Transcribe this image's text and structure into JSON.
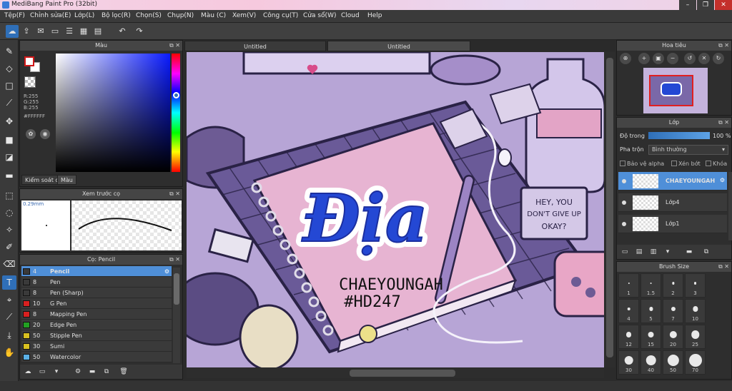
{
  "app": {
    "title": "MediBang Paint Pro (32bit)",
    "window_buttons": [
      "–",
      "❐",
      "✕"
    ]
  },
  "menu": [
    "Tệp(F)",
    "Chỉnh sửa(E)",
    "Lớp(L)",
    "Bộ lọc(R)",
    "Chọn(S)",
    "Chụp(N)",
    "Màu (C)",
    "Xem(V)",
    "Công cụ(T)",
    "Cửa sổ(W)",
    "Cloud",
    "Help"
  ],
  "toolbar_icons": [
    "cloud-icon",
    "share-icon",
    "comment-icon",
    "document-icon",
    "note-icon",
    "grid-icon",
    "tiles-icon",
    "undo-icon",
    "redo-icon"
  ],
  "color_panel": {
    "title": "Màu",
    "r": "R:255",
    "g": "G:255",
    "b": "B:255",
    "hex": "#FFFFFF",
    "tabs": [
      "Kiểm soát cọ",
      "Màu"
    ],
    "fg_color": "#FFFFFF",
    "fg_border": "#D01818"
  },
  "preview_panel": {
    "title": "Xem trước cọ",
    "size": "0.29mm"
  },
  "brush_panel": {
    "title": "Cọ: Pencil",
    "items": [
      {
        "size": "4",
        "name": "Pencil",
        "color": "#3a3a3a",
        "active": true
      },
      {
        "size": "8",
        "name": "Pen",
        "color": "#3a3a3a"
      },
      {
        "size": "8",
        "name": "Pen (Sharp)",
        "color": "#3a3a3a"
      },
      {
        "size": "10",
        "name": "G Pen",
        "color": "#d92020"
      },
      {
        "size": "8",
        "name": "Mapping Pen",
        "color": "#d92020"
      },
      {
        "size": "20",
        "name": "Edge Pen",
        "color": "#22a022"
      },
      {
        "size": "50",
        "name": "Stipple Pen",
        "color": "#d8c020"
      },
      {
        "size": "30",
        "name": "Sumi",
        "color": "#d8c020"
      },
      {
        "size": "50",
        "name": "Watercolor",
        "color": "#5ab0e6"
      }
    ]
  },
  "document": {
    "tabs": [
      "Untitled",
      "Untitled"
    ],
    "active_tab": 1,
    "artwork": {
      "title": "Địa",
      "signature_line1": "CHAEYOUNGAH",
      "signature_line2": "#HD247",
      "sticky_note": [
        "HEY, YOU",
        "DON'T GIVE UP",
        "OKAY?"
      ]
    }
  },
  "navigator": {
    "title": "Hoa tiêu",
    "buttons": [
      "zoom-fit-icon",
      "zoom-in-icon",
      "fit-window-icon",
      "zoom-out-icon",
      "rotate-left-icon",
      "reset-icon",
      "rotate-right-icon"
    ]
  },
  "layer_panel": {
    "title": "Lớp",
    "opacity_label": "Độ trong",
    "opacity_value": "100 %",
    "opacity_fraction": 1.0,
    "blend_label": "Pha trộn",
    "blend_value": "Bình thường",
    "alpha_lock": "Bảo vệ alpha",
    "clipping": "Xén bớt",
    "lock": "Khóa",
    "layers": [
      {
        "name": "CHAEYOUNGAH",
        "active": true
      },
      {
        "name": "Lớp4"
      },
      {
        "name": "Lớp1"
      }
    ]
  },
  "brush_size_panel": {
    "title": "Brush Size",
    "sizes": [
      "1",
      "1.5",
      "2",
      "3",
      "4",
      "5",
      "7",
      "10",
      "12",
      "15",
      "20",
      "25",
      "30",
      "40",
      "50",
      "70"
    ]
  }
}
